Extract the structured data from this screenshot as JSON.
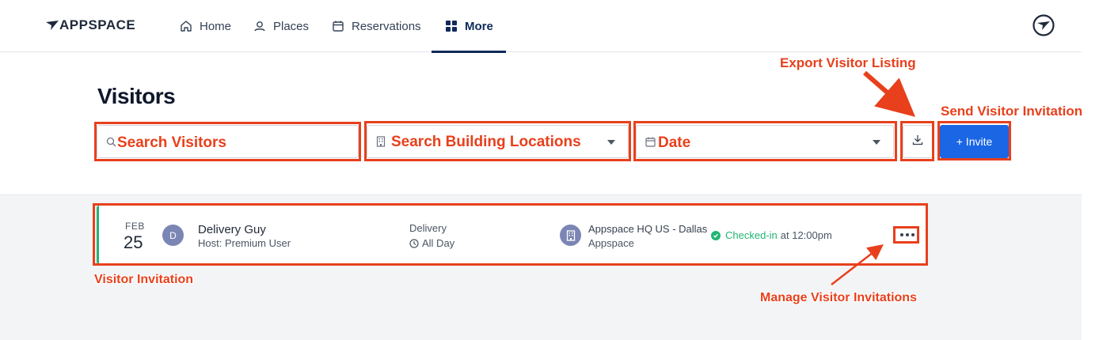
{
  "brand": {
    "logo_text": "APPSPACE",
    "accent": "#0f2a5a",
    "primary_button": "#1a66e5",
    "checked_in": "#22b573",
    "annotation": "#e8401c"
  },
  "nav": {
    "items": [
      {
        "label": "Home",
        "icon": "home-icon"
      },
      {
        "label": "Places",
        "icon": "places-icon"
      },
      {
        "label": "Reservations",
        "icon": "calendar-icon"
      },
      {
        "label": "More",
        "icon": "grid-icon",
        "active": true
      }
    ]
  },
  "page": {
    "title": "Visitors"
  },
  "filters": {
    "search_placeholder": "",
    "building_placeholder": "",
    "date_placeholder": ""
  },
  "toolbar": {
    "invite_label": "+ Invite"
  },
  "visitors": [
    {
      "month": "FEB",
      "day": "25",
      "avatar_initial": "D",
      "name": "Delivery Guy",
      "host": "Host: Premium User",
      "type": "Delivery",
      "time": "All Day",
      "building": "Appspace HQ US - Dallas",
      "org": "Appspace",
      "status": "Checked-in",
      "status_time": "at 12:00pm"
    }
  ],
  "annotations": {
    "search_visitors": "Search Visitors",
    "search_building": "Search Building Locations",
    "date": "Date",
    "export": "Export Visitor Listing",
    "send_invite": "Send Visitor Invitation",
    "visitor_invitation": "Visitor Invitation",
    "manage": "Manage Visitor Invitations"
  }
}
